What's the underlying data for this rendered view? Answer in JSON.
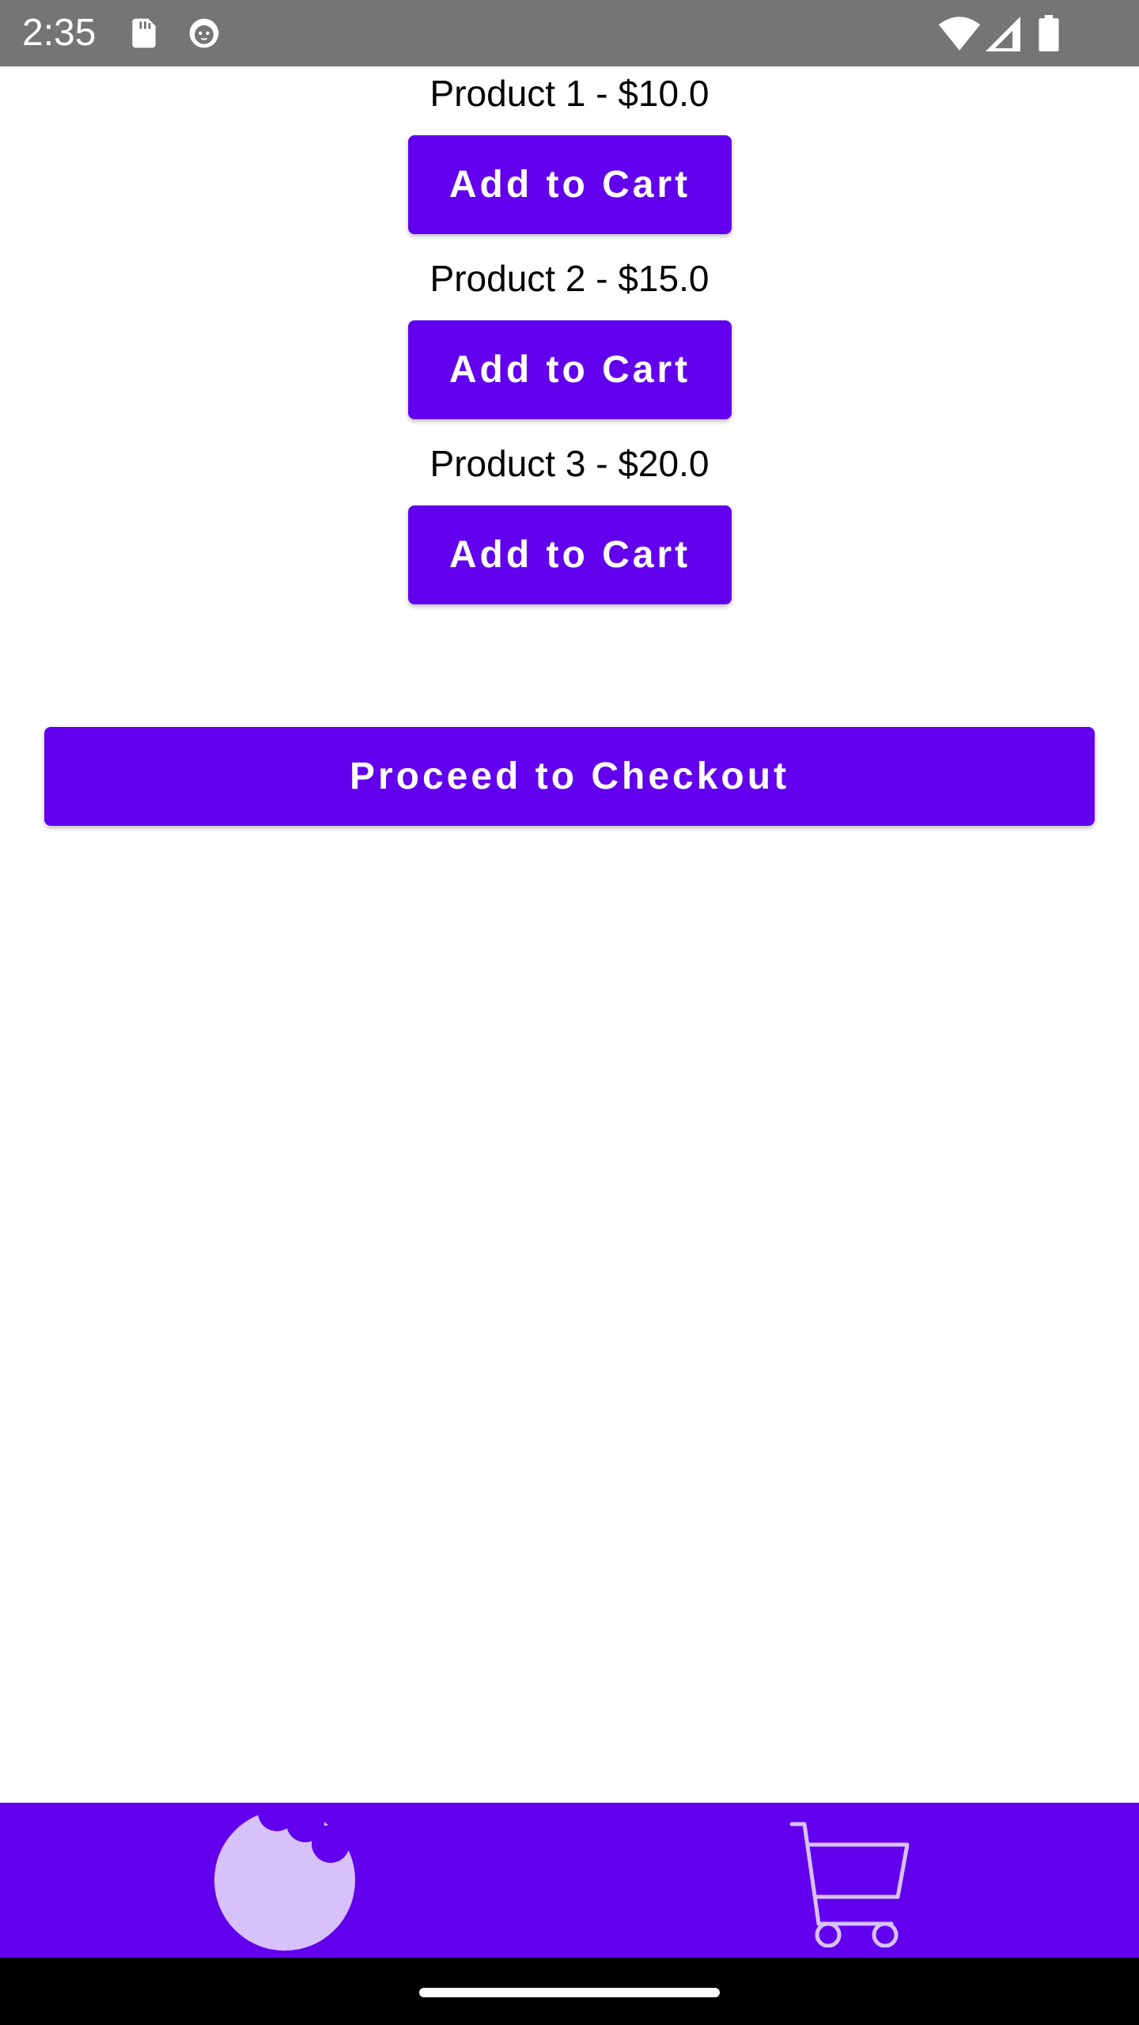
{
  "status_bar": {
    "time": "2:35",
    "icons": [
      "sd-card-icon",
      "cat-face-icon",
      "wifi-icon",
      "cell-signal-icon",
      "battery-icon"
    ]
  },
  "products": [
    {
      "label": "Product 1 - $10.0",
      "button_label": "Add to Cart"
    },
    {
      "label": "Product 2 - $15.0",
      "button_label": "Add to Cart"
    },
    {
      "label": "Product 3 - $20.0",
      "button_label": "Add to Cart"
    }
  ],
  "checkout": {
    "label": "Proceed to Checkout"
  },
  "bottom_nav": {
    "items": [
      {
        "icon": "cookie-icon",
        "selected": true
      },
      {
        "icon": "cart-icon",
        "selected": false
      }
    ]
  },
  "colors": {
    "primary": "#6200ee",
    "status_bar": "#757575",
    "nav_icon": "#d7c1fb"
  }
}
